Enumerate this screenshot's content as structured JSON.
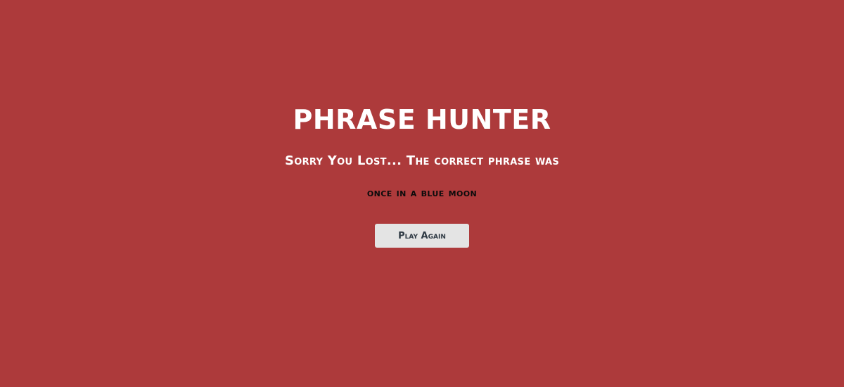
{
  "colors": {
    "background": "#ad3a3b",
    "title_text": "#ffffff",
    "phrase_text": "#0b0b0b",
    "button_bg": "#e4e4e4",
    "button_text": "#2f3a44"
  },
  "overlay": {
    "title": "PHRASE HUNTER",
    "message": "Sorry You Lost... The correct phrase was",
    "phrase": "once in a blue moon",
    "button_label": "Play Again"
  }
}
